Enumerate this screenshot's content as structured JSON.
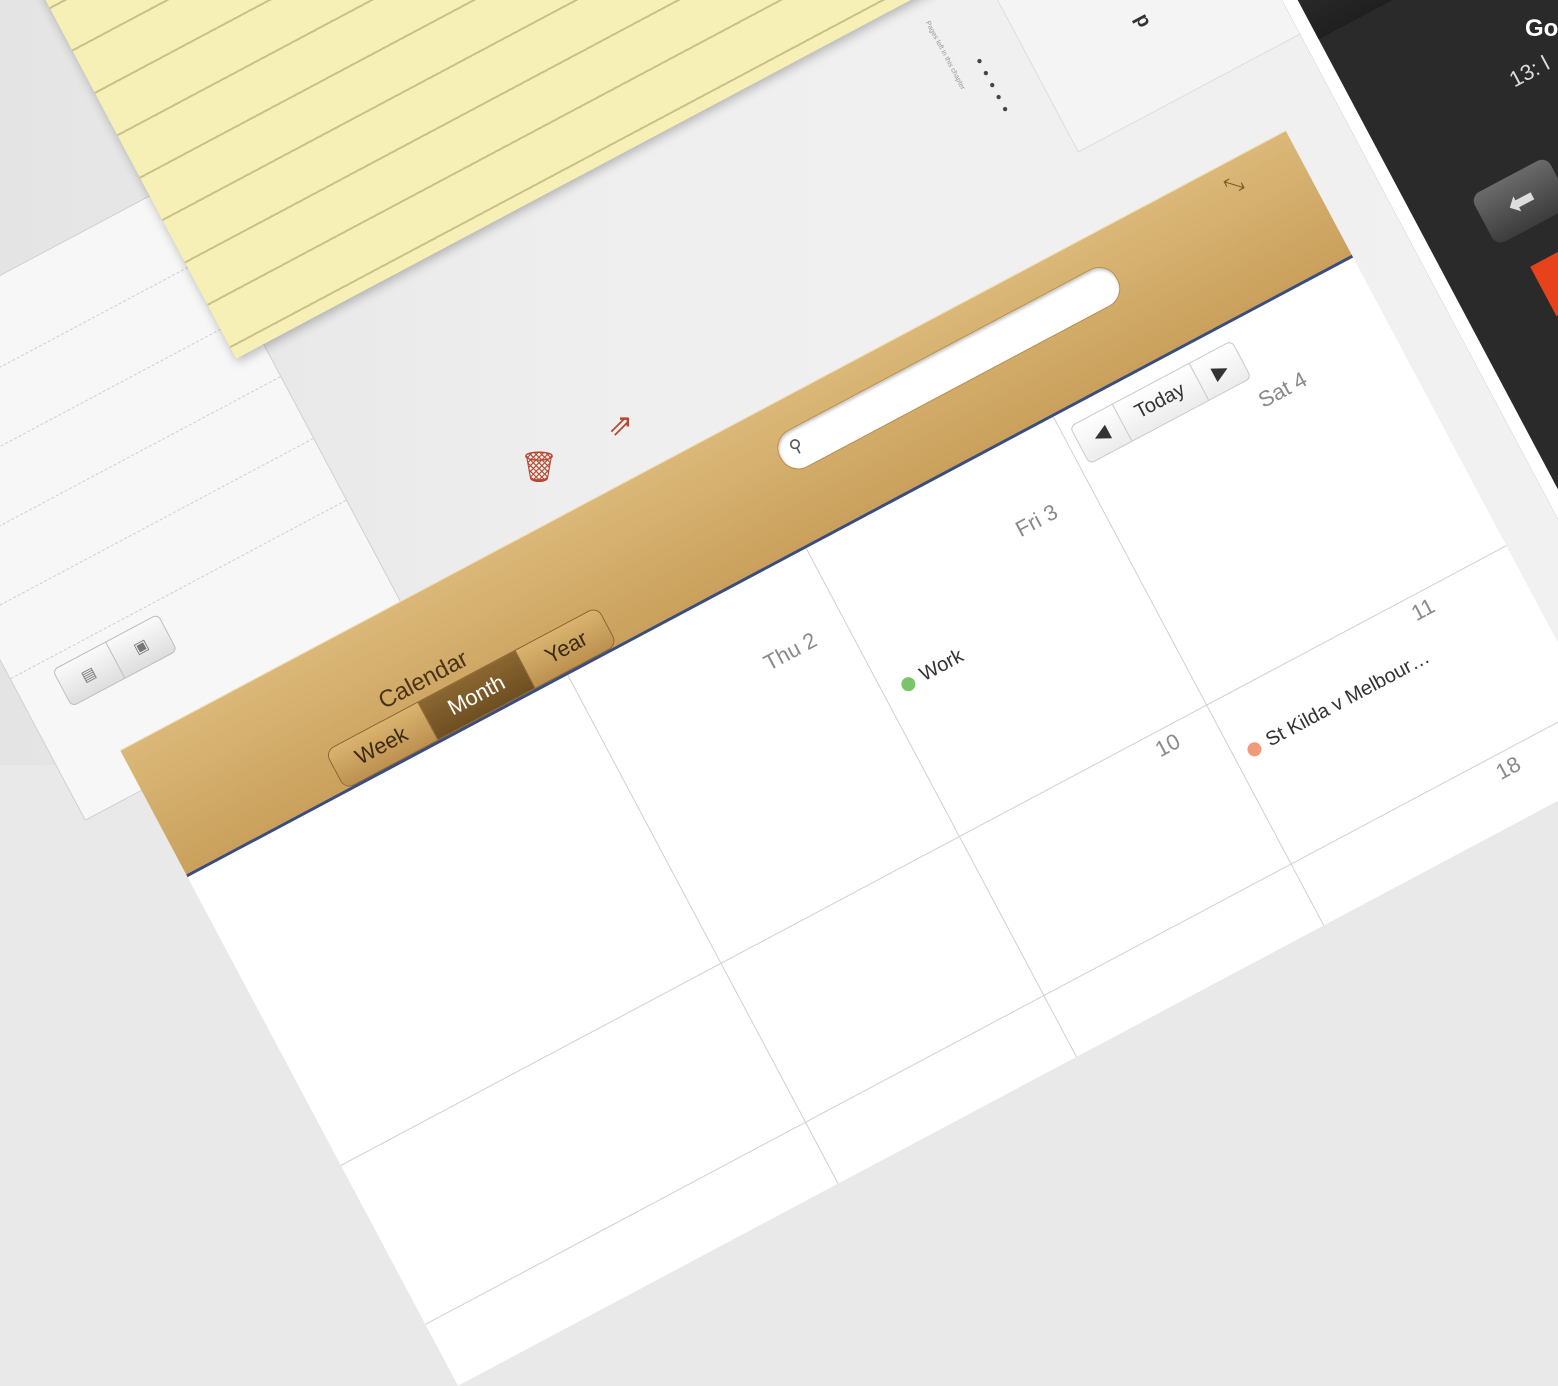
{
  "notes": {
    "trash_icon": "trash-icon",
    "share_icon": "share-icon"
  },
  "list_toggle": {
    "icons": [
      "list-icon",
      "detail-icon"
    ]
  },
  "document": {
    "bold_text": "p",
    "small_text": "Pages left in this chapter"
  },
  "calendar": {
    "title": "Calendar",
    "views": [
      "Week",
      "Month",
      "Year"
    ],
    "active_view": "Month",
    "search_placeholder": "",
    "nav": {
      "prev": "◀",
      "today": "Today",
      "next": "▶"
    },
    "day_labels": {
      "thu": "Thu 2",
      "fri": "Fri 3",
      "sat": "Sat 4",
      "d10": "10",
      "d11": "11",
      "d18": "18"
    },
    "events": [
      {
        "title": "Work",
        "color": "#7cc46a"
      },
      {
        "title": "St Kilda v Melbour…",
        "color": "#f09a7a"
      }
    ]
  },
  "player": {
    "title": "Go",
    "time": "13: l",
    "back_icon": "arrow-left-icon",
    "accent": "#e8421d"
  }
}
